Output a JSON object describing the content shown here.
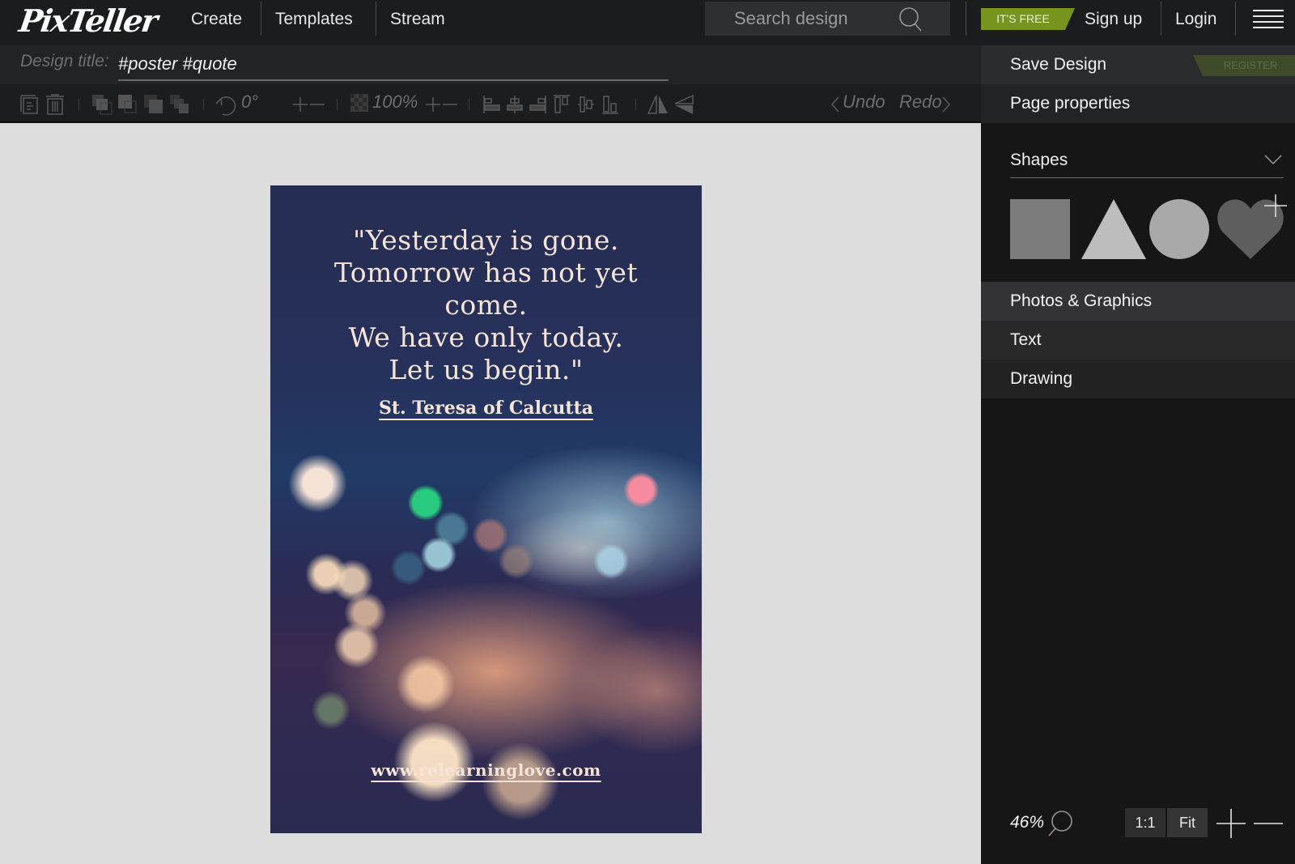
{
  "app": {
    "logo": "PixTeller",
    "colors": {
      "accent_green": "#76951f",
      "register_green": "#3f4a2a",
      "topbar": "#1b1c1e",
      "panel": "#161617"
    }
  },
  "nav": {
    "items": [
      {
        "label": "Create"
      },
      {
        "label": "Templates"
      },
      {
        "label": "Stream"
      }
    ],
    "search": {
      "placeholder": "Search design",
      "value": ""
    },
    "free_badge": "IT'S FREE",
    "signup": "Sign up",
    "login": "Login"
  },
  "design": {
    "title_label": "Design title:",
    "title_value": "#poster #quote"
  },
  "toolbar": {
    "rotation": "0°",
    "opacity": "100%",
    "undo": "Undo",
    "redo": "Redo",
    "icons": [
      "duplicate-icon",
      "delete-icon",
      "bring-to-front-icon",
      "bring-forward-icon",
      "send-backward-icon",
      "send-to-back-icon",
      "rotate-icon",
      "opacity-icon",
      "align-left-icon",
      "align-center-icon",
      "align-right-icon",
      "align-top-icon",
      "align-middle-icon",
      "align-bottom-icon",
      "flip-horizontal-icon",
      "flip-vertical-icon"
    ]
  },
  "poster": {
    "quote": "\"Yesterday is gone.\nTomorrow has not yet\ncome.\nWe have only today.\nLet us begin.\"",
    "author": "St. Teresa of Calcutta",
    "url": "www.relearninglove.com"
  },
  "panel": {
    "save_design": "Save Design",
    "register": "REGISTER",
    "page_properties": "Page properties",
    "shapes_title": "Shapes",
    "shapes": [
      "square",
      "triangle",
      "circle",
      "heart"
    ],
    "sections": [
      {
        "label": "Photos & Graphics"
      },
      {
        "label": "Text"
      },
      {
        "label": "Drawing"
      }
    ],
    "zoom": {
      "level": "46%",
      "one_to_one": "1:1",
      "fit": "Fit"
    }
  }
}
